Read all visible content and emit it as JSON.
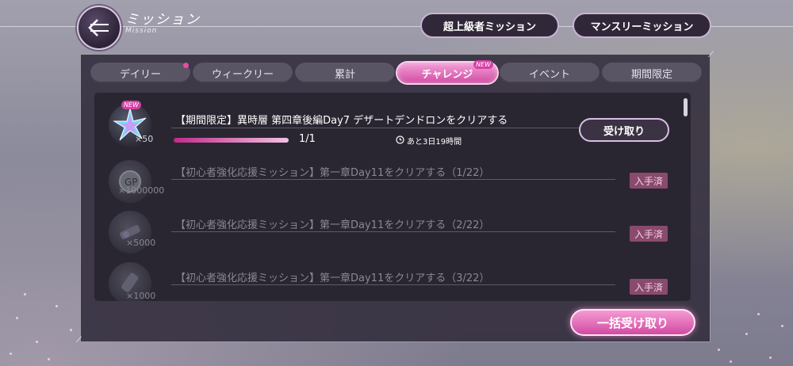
{
  "header": {
    "title": "ミッション",
    "subtitle": "Mission",
    "back_icon": "back-arrow-icon",
    "buttons": [
      "超上級者ミッション",
      "マンスリーミッション"
    ]
  },
  "tabs": [
    {
      "label": "デイリー",
      "active": false,
      "dot": true
    },
    {
      "label": "ウィークリー",
      "active": false
    },
    {
      "label": "累計",
      "active": false
    },
    {
      "label": "チャレンジ",
      "active": true,
      "badge": "NEW"
    },
    {
      "label": "イベント",
      "active": false
    },
    {
      "label": "期間限定",
      "active": false
    }
  ],
  "missions": [
    {
      "badge": "NEW",
      "reward_icon": "star-crystal-icon",
      "reward_qty": "×50",
      "title": "【期間限定】異時層 第四章後編Day7 デザートデンドロンをクリアする",
      "progress_text": "1/1",
      "progress": 1.0,
      "time_left": "あと3日19時間",
      "action": "受け取り"
    },
    {
      "reward_icon": "gp-coin-icon",
      "reward_qty": "×1000000",
      "title": "【初心者強化応援ミッション】第一章Day11をクリアする（1/22）",
      "status": "入手済"
    },
    {
      "reward_icon": "material-item-icon",
      "reward_qty": "×5000",
      "title": "【初心者強化応援ミッション】第一章Day11をクリアする（2/22）",
      "status": "入手済"
    },
    {
      "reward_icon": "material-item-icon",
      "reward_qty": "×1000",
      "title": "【初心者強化応援ミッション】第一章Day11をクリアする（3/22）",
      "status": "入手済"
    }
  ],
  "bulk_receive": "一括受け取り",
  "colors": {
    "accent": "#d24aa2",
    "panel": "#342f3e",
    "claimed": "#8a4a6e"
  }
}
